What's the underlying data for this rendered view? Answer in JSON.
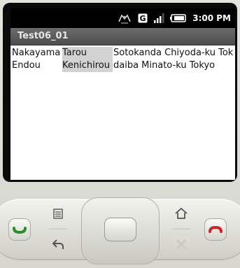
{
  "status_bar": {
    "time": "3:00 PM",
    "icons": [
      "android-debug-icon",
      "gps-g-icon",
      "signal-bars-icon",
      "battery-icon"
    ],
    "network_label": "G"
  },
  "app": {
    "title": "Test06_01"
  },
  "list": {
    "rows": [
      {
        "last_name": "Nakayama",
        "first_name": "Tarou",
        "address": "Sotokanda Chiyoda-ku Tok"
      },
      {
        "last_name": "Endou",
        "first_name": "Kenichirou",
        "address": "daiba Minato-ku Tokyo"
      }
    ]
  },
  "hardware_keys": [
    "call-icon",
    "menu-icon",
    "back-icon",
    "dpad-center",
    "home-icon",
    "search-icon",
    "end-call-icon"
  ],
  "colors": {
    "call_green": "#2e8b2e",
    "end_red": "#c62828",
    "title_bar": "#555555",
    "highlight": "#d2d2d2"
  }
}
